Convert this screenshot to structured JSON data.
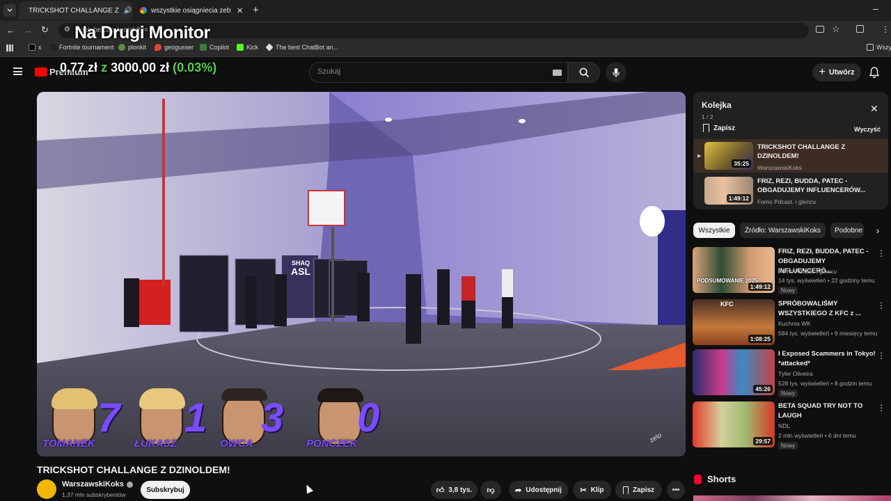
{
  "browser": {
    "tabs": [
      {
        "title": "TRICKSHOT CHALLANGE Z",
        "favicon": "youtube-icon",
        "active": true
      },
      {
        "title": "wszystkie osiągniecia zeby odbl",
        "favicon": "google-icon",
        "active": false
      }
    ],
    "address_text": "youtube.com/watch?v=",
    "bookmarks": [
      "x",
      "Fortnite tournament",
      "plonkit",
      "geogusser",
      "Copilot",
      "Kick",
      "The best ChatBot an..."
    ],
    "bookmarks_right": "Wszy"
  },
  "overlay": {
    "title": "Na Drugi Monitor",
    "money_current": "0,77 zł",
    "money_of": "z",
    "money_goal": "3000,00 zł",
    "money_pct": "(0.03%)",
    "money_progress": 0.0003
  },
  "youtube": {
    "logo_text": "Premium",
    "search_placeholder": "Szukaj",
    "create_label": "Utwórz"
  },
  "video": {
    "title": "TRICKSHOT CHALLANGE Z DZINOLDEM!",
    "scoreboard": [
      {
        "name": "TOMANEK",
        "score": "7"
      },
      {
        "name": "ŁUKASZ",
        "score": "1"
      },
      {
        "name": "OWCA",
        "score": "3"
      },
      {
        "name": "PONCZEK",
        "score": "0"
      }
    ],
    "banner_text": "SHAQ",
    "banner_text2": "ASL",
    "watermark": "zelo"
  },
  "channel": {
    "name": "WarszawskiKoks",
    "subscribers": "1,37 mln subskrybentów",
    "subscribe_label": "Subskrybuj"
  },
  "actions": {
    "likes": "3,8 tys.",
    "share": "Udostępnij",
    "clip": "Klip",
    "save": "Zapisz"
  },
  "queue": {
    "title": "Kolejka",
    "position": "1 / 2",
    "save_label": "Zapisz",
    "clear_label": "Wyczyść",
    "items": [
      {
        "title": "TRICKSHOT CHALLANGE Z DZINOLDEM!",
        "channel": "WarszawskiKoks",
        "duration": "35:25"
      },
      {
        "title": "FRIZ, REZI, BUDDA, PATEC - OBGADUJEMY INFLUENCERÓW...",
        "channel": "Fomo Pdcast. i glencu",
        "duration": "1:49:12"
      }
    ]
  },
  "chips": [
    "Wszystkie",
    "Źródło: WarszawskiKoks",
    "Podobne"
  ],
  "recommendations": [
    {
      "title": "FRIZ, REZI, BUDDA, PATEC - OBGADUJEMY INFLUENCERÓ...",
      "channel": "Fomo Pdcast. i glencu",
      "meta": "14 tys. wyświetleń • 22 godziny temu",
      "duration": "1:49:12",
      "badge": "Nowy",
      "thumb_text": "PODSUMOWANIE 2025"
    },
    {
      "title": "SPRÓBOWALIŚMY WSZYSTKIEGO Z KFC z ...",
      "channel": "Kuchnia WK",
      "meta": "584 tys. wyświetleń • 9 miesięcy temu",
      "duration": "1:08:25",
      "badge": "",
      "thumb_text": "KFC"
    },
    {
      "title": "I Exposed Scammers in Tokyo! *attacked*",
      "channel": "Tyler Oliveira",
      "meta": "528 tys. wyświetleń • 8 godzin temu",
      "duration": "45:26",
      "badge": "Nowy",
      "thumb_text": ""
    },
    {
      "title": "BETA SQUAD TRY NOT TO LAUGH",
      "channel": "NDL",
      "meta": "2 mln wyświetleń • 6 dni temu",
      "duration": "29:57",
      "badge": "Nowy",
      "thumb_text": ""
    }
  ],
  "shorts_label": "Shorts"
}
